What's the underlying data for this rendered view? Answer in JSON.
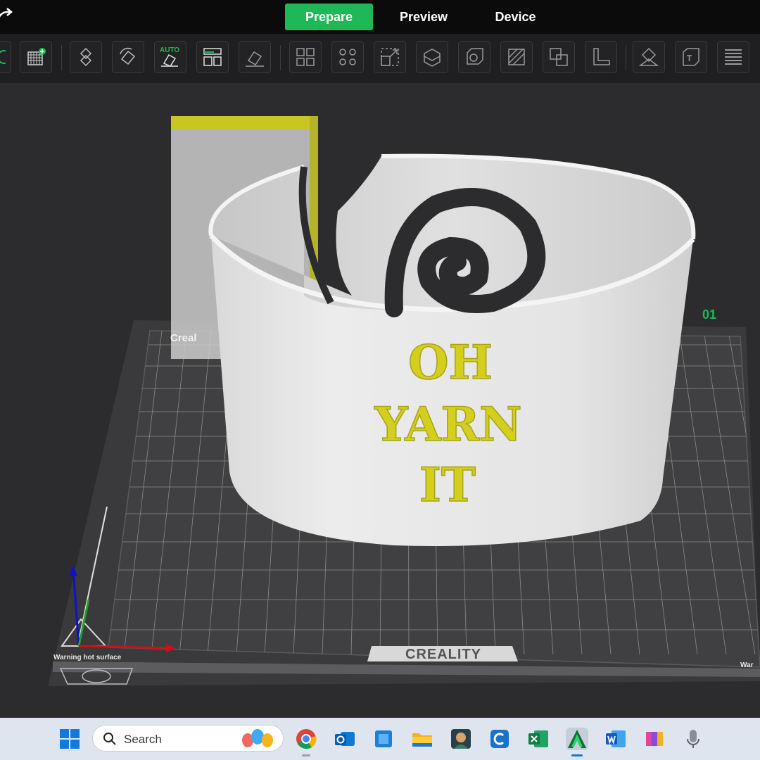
{
  "nav": {
    "prepare": "Prepare",
    "preview": "Preview",
    "device": "Device",
    "active": "prepare"
  },
  "toolbar": {
    "auto_badge": "AUTO"
  },
  "model": {
    "line1": "OH",
    "line2": "YARN",
    "line3": "IT",
    "text_color": "#d4cf1c",
    "body_color": "#e9e9e9"
  },
  "bed": {
    "plate_number": "01",
    "brand": "CREALITY",
    "warning": "Warning hot surface",
    "warning_right": "War",
    "back_label": "Creal"
  },
  "taskbar": {
    "search_placeholder": "Search"
  },
  "colors": {
    "accent": "#1fb857"
  }
}
